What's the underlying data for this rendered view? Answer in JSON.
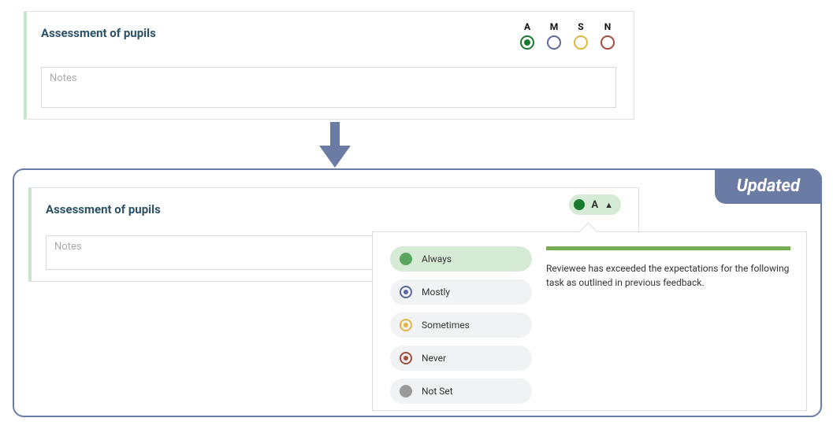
{
  "old": {
    "title": "Assessment of pupils",
    "notes_placeholder": "Notes",
    "ratings": [
      {
        "key": "A",
        "color": "#187a2e",
        "selected": true
      },
      {
        "key": "M",
        "color": "#5b6aa0",
        "selected": false
      },
      {
        "key": "S",
        "color": "#e0b544",
        "selected": false
      },
      {
        "key": "N",
        "color": "#a24d3b",
        "selected": false
      }
    ]
  },
  "new": {
    "badge": "Updated",
    "title": "Assessment of pupils",
    "notes_placeholder": "Notes",
    "selected_label": "A"
  },
  "dropdown": {
    "options": [
      {
        "label": "Always",
        "color": "#59a65e",
        "selected": true,
        "ring": false
      },
      {
        "label": "Mostly",
        "color": "#5b6aa0",
        "selected": false,
        "ring": true
      },
      {
        "label": "Sometimes",
        "color": "#e0b544",
        "selected": false,
        "ring": true
      },
      {
        "label": "Never",
        "color": "#a24d3b",
        "selected": false,
        "ring": true
      },
      {
        "label": "Not Set",
        "color": "#9a9a9a",
        "selected": false,
        "ring": false
      }
    ],
    "description": "Reviewee has exceeded the expectations for the following task as outlined in previous feedback."
  }
}
